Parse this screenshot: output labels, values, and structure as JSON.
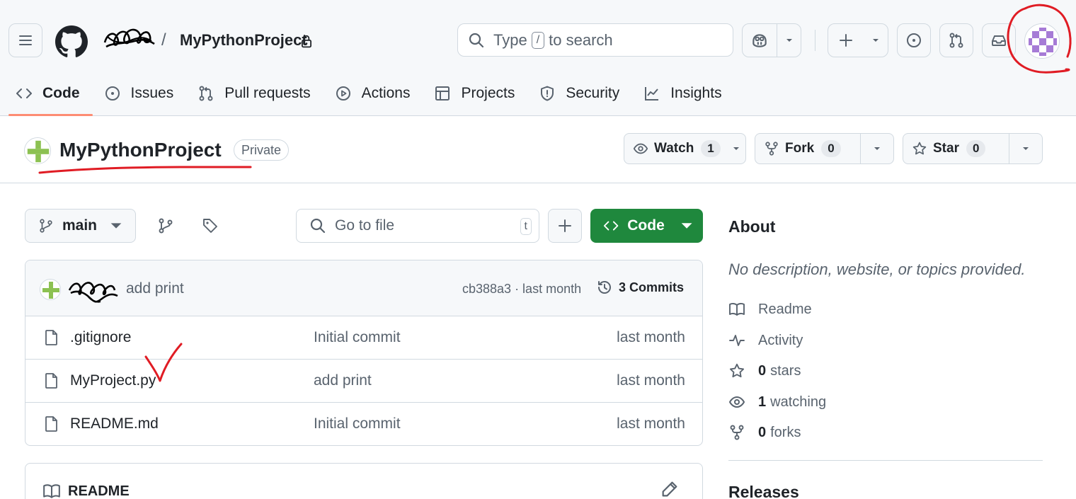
{
  "header": {
    "repo_name": "MyPythonProject",
    "path_separator": "/",
    "search": {
      "before": "Type",
      "key": "/",
      "after": "to search"
    }
  },
  "tabs": [
    {
      "label": "Code"
    },
    {
      "label": "Issues"
    },
    {
      "label": "Pull requests"
    },
    {
      "label": "Actions"
    },
    {
      "label": "Projects"
    },
    {
      "label": "Security"
    },
    {
      "label": "Insights"
    }
  ],
  "repo": {
    "title": "MyPythonProject",
    "visibility": "Private",
    "watch": {
      "label": "Watch",
      "count": "1"
    },
    "fork": {
      "label": "Fork",
      "count": "0"
    },
    "star": {
      "label": "Star",
      "count": "0"
    }
  },
  "file_nav": {
    "branch": "main",
    "goto_placeholder": "Go to file",
    "goto_key": "t",
    "code_label": "Code"
  },
  "latest_commit": {
    "message": "add print",
    "hash_time": "cb388a3 · last month",
    "commits_label": "3 Commits"
  },
  "files": [
    {
      "name": ".gitignore",
      "message": "Initial commit",
      "date": "last month"
    },
    {
      "name": "MyProject.py",
      "message": "add print",
      "date": "last month"
    },
    {
      "name": "README.md",
      "message": "Initial commit",
      "date": "last month"
    }
  ],
  "readme": {
    "title": "README"
  },
  "about": {
    "heading": "About",
    "description": "No description, website, or topics provided.",
    "readme_label": "Readme",
    "activity_label": "Activity",
    "stars": {
      "count": "0",
      "label": "stars"
    },
    "watching": {
      "count": "1",
      "label": "watching"
    },
    "forks": {
      "count": "0",
      "label": "forks"
    }
  },
  "releases": {
    "heading": "Releases"
  },
  "colors": {
    "accent_green": "#1f883d",
    "tab_underline": "#fd8c73",
    "annotation_red": "#e01c24",
    "header_bg": "#f6f8fa",
    "avatar_purple": "#a67bd6"
  },
  "icons": {
    "menu": "hamburger-icon",
    "logo": "github-mark-icon",
    "lock": "lock-icon",
    "search": "search-icon",
    "copilot": "copilot-icon",
    "plus": "plus-icon",
    "issues": "issue-opened-icon",
    "pulls": "git-pull-request-icon",
    "inbox": "inbox-icon"
  }
}
